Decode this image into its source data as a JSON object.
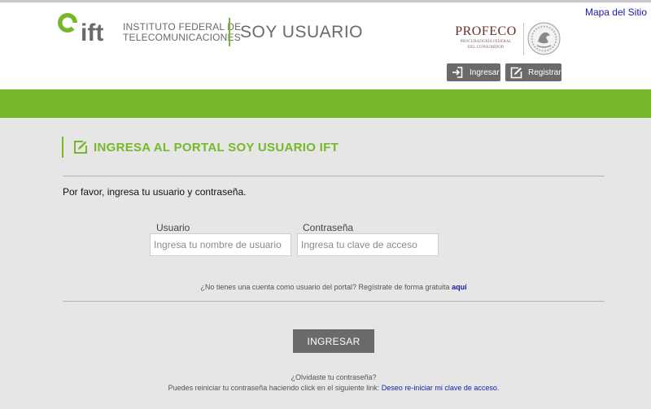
{
  "header": {
    "sitemap_link": "Mapa del Sitio",
    "ift_line1": "INSTITUTO FEDERAL DE",
    "ift_line2": "TELECOMUNICACIONES",
    "portal_title": "SOY USUARIO",
    "profeco_name": "PROFECO",
    "profeco_sub1": "PROCURADURÍA FEDERAL",
    "profeco_sub2": "DEL CONSUMIDOR",
    "ingresar_label": "Ingresar",
    "registrar_label": "Registrar"
  },
  "colors": {
    "brand_green": "#76b82a",
    "button_gray": "#6a6a6a",
    "link_blue": "#1a1aa6"
  },
  "main": {
    "heading": "INGRESA AL PORTAL SOY USUARIO IFT",
    "instruction": "Por favor, ingresa tu usuario y contraseña.",
    "user_label": "Usuario",
    "user_placeholder": "Ingresa tu nombre de usuario",
    "pass_label": "Contraseña",
    "pass_placeholder": "Ingresa tu clave de acceso",
    "no_account_text": "¿No tienes una cuenta como usuario del portal? Regístrate de forma gratuita",
    "no_account_link": "aquí",
    "login_button": "INGRESAR",
    "forgot_text": "¿Olvidaste tu contraseña?",
    "reset_text": "Puedes reiniciar tu contraseña haciendo click en el siguiente link:",
    "reset_link": "Deseo re-iniciar mi clave de acceso."
  },
  "icons": {
    "ift_logo": "ift-logo-icon",
    "seal": "mexico-seal-icon",
    "ingresar": "login-icon",
    "registrar": "edit-icon",
    "heading": "edit-icon"
  }
}
